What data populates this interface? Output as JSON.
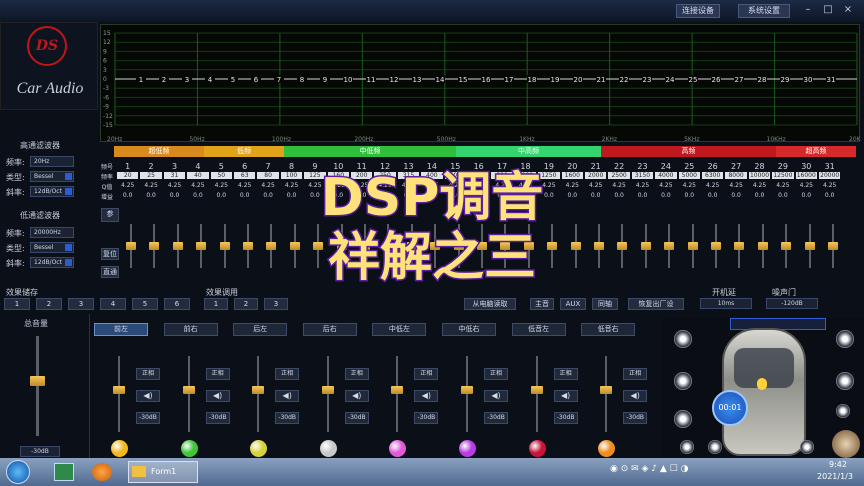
{
  "titlebar": {
    "connect_btn": "连接设备",
    "settings_btn": "系统设置"
  },
  "logo": {
    "badge": "DS",
    "text": "Car Audio"
  },
  "graph": {
    "y_ticks": [
      "15",
      "12",
      "9",
      "6",
      "3",
      "0",
      "-3",
      "-6",
      "-9",
      "-12",
      "-15"
    ],
    "x_ticks": [
      "20Hz",
      "50Hz",
      "100Hz",
      "200Hz",
      "500Hz",
      "1KHz",
      "2KHz",
      "5KHz",
      "10KHz",
      "20KHz"
    ],
    "points": [
      "1",
      "2",
      "3",
      "4",
      "5",
      "6",
      "7",
      "8",
      "9",
      "10",
      "11",
      "12",
      "13",
      "14",
      "15",
      "16",
      "17",
      "18",
      "19",
      "20",
      "21",
      "22",
      "23",
      "24",
      "25",
      "26",
      "27",
      "28",
      "29",
      "30",
      "31"
    ]
  },
  "bands": [
    {
      "label": "超低频",
      "color": "#d98a1e"
    },
    {
      "label": "低频",
      "color": "#e0a31a"
    },
    {
      "label": "中低频",
      "color": "#2fbf3a"
    },
    {
      "label": "中高频",
      "color": "#34d46e"
    },
    {
      "label": "高频",
      "color": "#c0181f"
    },
    {
      "label": "超高频",
      "color": "#d62a2a"
    }
  ],
  "hp_filter": {
    "title": "高通滤波器",
    "freq_label": "频率:",
    "freq": "20Hz",
    "type_label": "类型:",
    "type": "Bessel",
    "slope_label": "斜率:",
    "slope": "12dB/Oct"
  },
  "lp_filter": {
    "title": "低通滤波器",
    "freq_label": "频率:",
    "freq": "20000Hz",
    "type_label": "类型:",
    "type": "Bessel",
    "slope_label": "斜率:",
    "slope": "12dB/Oct"
  },
  "table": {
    "row_labels": [
      "频号",
      "频率",
      "Q值",
      "增益"
    ],
    "nums": [
      "1",
      "2",
      "3",
      "4",
      "5",
      "6",
      "7",
      "8",
      "9",
      "10",
      "11",
      "12",
      "13",
      "14",
      "15",
      "16",
      "17",
      "18",
      "19",
      "20",
      "21",
      "22",
      "23",
      "24",
      "25",
      "26",
      "27",
      "28",
      "29",
      "30",
      "31"
    ],
    "freqs": [
      "20",
      "25",
      "31",
      "40",
      "50",
      "63",
      "80",
      "100",
      "125",
      "160",
      "200",
      "250",
      "315",
      "400",
      "500",
      "630",
      "800",
      "1000",
      "1250",
      "1600",
      "2000",
      "2500",
      "3150",
      "4000",
      "5000",
      "6300",
      "8000",
      "10000",
      "12500",
      "16000",
      "20000"
    ],
    "q": "4.25",
    "gain": "0.0"
  },
  "eq_side": {
    "param": "参",
    "reset": "复位",
    "direct": "直通"
  },
  "eq_gains": [
    0,
    0,
    0,
    0,
    0,
    0,
    0,
    0,
    0,
    0,
    0,
    0,
    0,
    0,
    0,
    0,
    0,
    0,
    0,
    0,
    0,
    0,
    0,
    0,
    0,
    0,
    0,
    0,
    0,
    0,
    0
  ],
  "effect_store": {
    "title": "效果储存",
    "buttons": [
      "1",
      "2",
      "3",
      "4",
      "5",
      "6"
    ]
  },
  "effect_call": {
    "title": "效果调用",
    "buttons": [
      "1",
      "2",
      "3"
    ],
    "read_btn": "从电脑读取"
  },
  "inputs": {
    "hifi": "主音",
    "aux": "AUX",
    "sync": "同轴",
    "factory": "恢复出厂设"
  },
  "power_delay": {
    "title": "开机延",
    "value": "10ms"
  },
  "noise_gate": {
    "title": "噪声门",
    "value": "-120dB"
  },
  "master": {
    "title": "总音量",
    "value": "-30dB",
    "level": 0.55
  },
  "channels": [
    {
      "name": "前左",
      "color": "#f2b81f",
      "level": 0.55
    },
    {
      "name": "前右",
      "color": "#3fc53a",
      "level": 0.55
    },
    {
      "name": "后左",
      "color": "#d5d23a",
      "level": 0.55
    },
    {
      "name": "后右",
      "color": "#c8c8c8",
      "level": 0.55
    },
    {
      "name": "中低左",
      "color": "#e05ad8",
      "level": 0.55
    },
    {
      "name": "中低右",
      "color": "#b93ce0",
      "level": 0.55
    },
    {
      "name": "低音左",
      "color": "#c8143a",
      "level": 0.55
    },
    {
      "name": "低音右",
      "color": "#f08c1e",
      "level": 0.55
    }
  ],
  "channel_common": {
    "phase": "正相",
    "db": "-30dB"
  },
  "car": {
    "timer": "00:01"
  },
  "overlay": {
    "line1": "DSP调音",
    "line2": "祥解之三"
  },
  "taskbar": {
    "app": "Form1",
    "time": "9:42",
    "date": "2021/1/3"
  }
}
